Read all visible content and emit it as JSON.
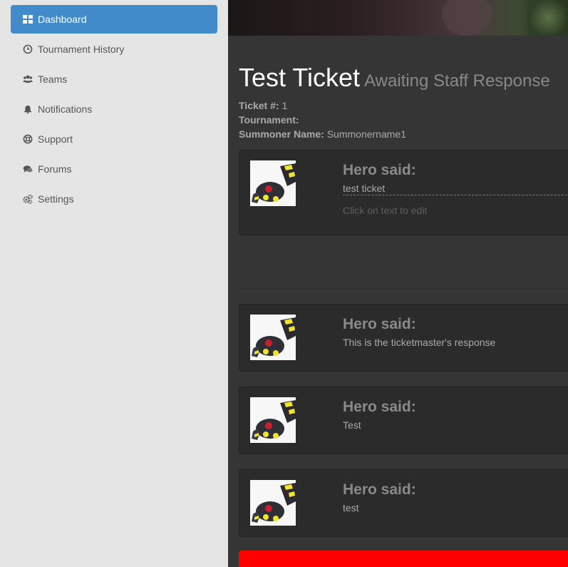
{
  "sidebar": {
    "items": [
      {
        "label": "Dashboard",
        "icon": "dashboard-icon",
        "active": true
      },
      {
        "label": "Tournament History",
        "icon": "clock-icon"
      },
      {
        "label": "Teams",
        "icon": "users-icon"
      },
      {
        "label": "Notifications",
        "icon": "bell-icon"
      },
      {
        "label": "Support",
        "icon": "life-ring-icon"
      },
      {
        "label": "Forums",
        "icon": "comments-icon"
      },
      {
        "label": "Settings",
        "icon": "gears-icon"
      }
    ]
  },
  "ticket": {
    "title": "Test Ticket",
    "status": "Awaiting Staff Response",
    "number_label": "Ticket #:",
    "number": "1",
    "tournament_label": "Tournament:",
    "tournament": "",
    "summoner_label": "Summoner Name:",
    "summoner": "Summonername1"
  },
  "posts": [
    {
      "author": "Hero said:",
      "text": "test ticket",
      "hint": "Click on text to edit"
    },
    {
      "author": "Hero said:",
      "text": "This is the ticketmaster's response"
    },
    {
      "author": "Hero said:",
      "text": "Test"
    },
    {
      "author": "Hero said:",
      "text": "test"
    }
  ],
  "colors": {
    "accent": "#428bca",
    "alert": "#ff0000",
    "sidebar_bg": "#e5e5e5",
    "main_bg": "#353535"
  }
}
